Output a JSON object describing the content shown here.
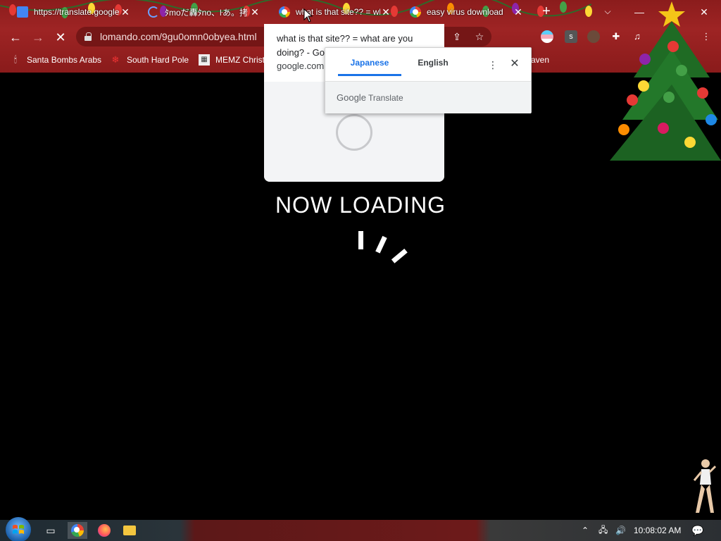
{
  "tabs": [
    {
      "title": "https://translate.google.com",
      "icon": "translate-favicon"
    },
    {
      "title": "ﾀmoだ轟ﾀno、ŀあ。拷",
      "icon": "loading-spinner-icon"
    },
    {
      "title": "what is that site?? = what are you doing?",
      "icon": "google-favicon"
    },
    {
      "title": "easy virus download",
      "icon": "google-favicon"
    }
  ],
  "window": {
    "minimize": "—",
    "maximize": "☐",
    "close": "✕"
  },
  "toolbar": {
    "back": "←",
    "forward": "→",
    "stop": "✕"
  },
  "omnibox": {
    "url": "lomando.com/9gu0omn0obyea.html"
  },
  "bookmarks": [
    {
      "label": "Santa Bombs Arabs",
      "icon": "candle-icon"
    },
    {
      "label": "South Hard Pole",
      "icon": "snowflake-icon"
    },
    {
      "label": "MEMZ Christ",
      "icon": "image-icon"
    },
    {
      "label": "aven",
      "icon": ""
    }
  ],
  "hover_card": {
    "title": "what is that site?? = what are you doing? - Go",
    "domain": "google.com"
  },
  "translate_bubble": {
    "tab_source": "Japanese",
    "tab_target": "English",
    "brand_google": "Google",
    "brand_translate": "Translate"
  },
  "page": {
    "loading_text": "NOW LOADING"
  },
  "taskbar": {
    "clock": "10:08:02 AM"
  },
  "colors": {
    "frame": "#9e2424",
    "accent": "#1a73e8",
    "background": "#000000"
  }
}
